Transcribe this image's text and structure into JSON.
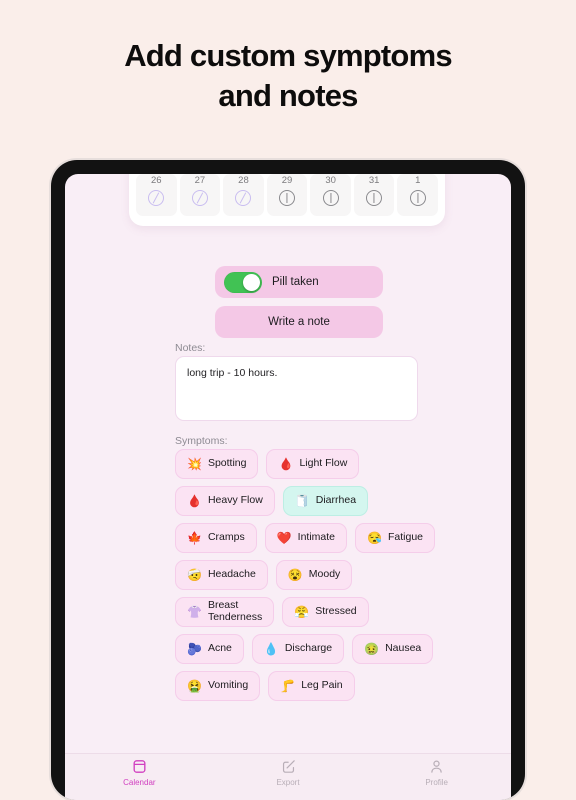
{
  "headline": {
    "line1": "Add custom symptoms",
    "line2": "and notes"
  },
  "calendar_strip": {
    "days": [
      {
        "num": "26",
        "state": "past"
      },
      {
        "num": "27",
        "state": "past"
      },
      {
        "num": "28",
        "state": "past"
      },
      {
        "num": "29",
        "state": "now"
      },
      {
        "num": "30",
        "state": "now"
      },
      {
        "num": "31",
        "state": "now"
      },
      {
        "num": "1",
        "state": "now"
      }
    ]
  },
  "actions": {
    "pill_taken_label": "Pill taken",
    "pill_taken_on": true,
    "write_note_label": "Write a note"
  },
  "notes": {
    "label": "Notes:",
    "value": "long trip - 10 hours."
  },
  "symptoms": {
    "label": "Symptoms:",
    "items": [
      {
        "label": "Spotting",
        "emoji": "💥",
        "selected": false
      },
      {
        "label": "Light Flow",
        "emoji": "🩸",
        "selected": false
      },
      {
        "label": "Heavy Flow",
        "emoji": "🩸",
        "selected": false
      },
      {
        "label": "Diarrhea",
        "emoji": "🧻",
        "selected": true
      },
      {
        "label": "Cramps",
        "emoji": "🍁",
        "selected": false
      },
      {
        "label": "Intimate",
        "emoji": "❤️",
        "selected": false
      },
      {
        "label": "Fatigue",
        "emoji": "😪",
        "selected": false
      },
      {
        "label": "Headache",
        "emoji": "🤕",
        "selected": false
      },
      {
        "label": "Moody",
        "emoji": "😵",
        "selected": false
      },
      {
        "label": "Breast\nTenderness",
        "emoji": "👚",
        "selected": false
      },
      {
        "label": "Stressed",
        "emoji": "😤",
        "selected": false
      },
      {
        "label": "Acne",
        "emoji": "🫐",
        "selected": false
      },
      {
        "label": "Discharge",
        "emoji": "💧",
        "selected": false
      },
      {
        "label": "Nausea",
        "emoji": "🤢",
        "selected": false
      },
      {
        "label": "Vomiting",
        "emoji": "🤮",
        "selected": false
      },
      {
        "label": "Leg Pain",
        "emoji": "🦵",
        "selected": false
      }
    ]
  },
  "tabbar": {
    "tabs": [
      {
        "label": "Calendar",
        "icon": "calendar-icon",
        "active": true
      },
      {
        "label": "Export",
        "icon": "export-icon",
        "active": false
      },
      {
        "label": "Profile",
        "icon": "profile-icon",
        "active": false
      }
    ]
  },
  "colors": {
    "page_bg": "#faeeea",
    "screen_bg": "#f9eef6",
    "accent_pink": "#f4c8e6",
    "toggle_on": "#41c254",
    "chip_bg": "#fbe3f3",
    "chip_selected_bg": "#d4f6ef",
    "tab_active": "#d13fc0"
  }
}
